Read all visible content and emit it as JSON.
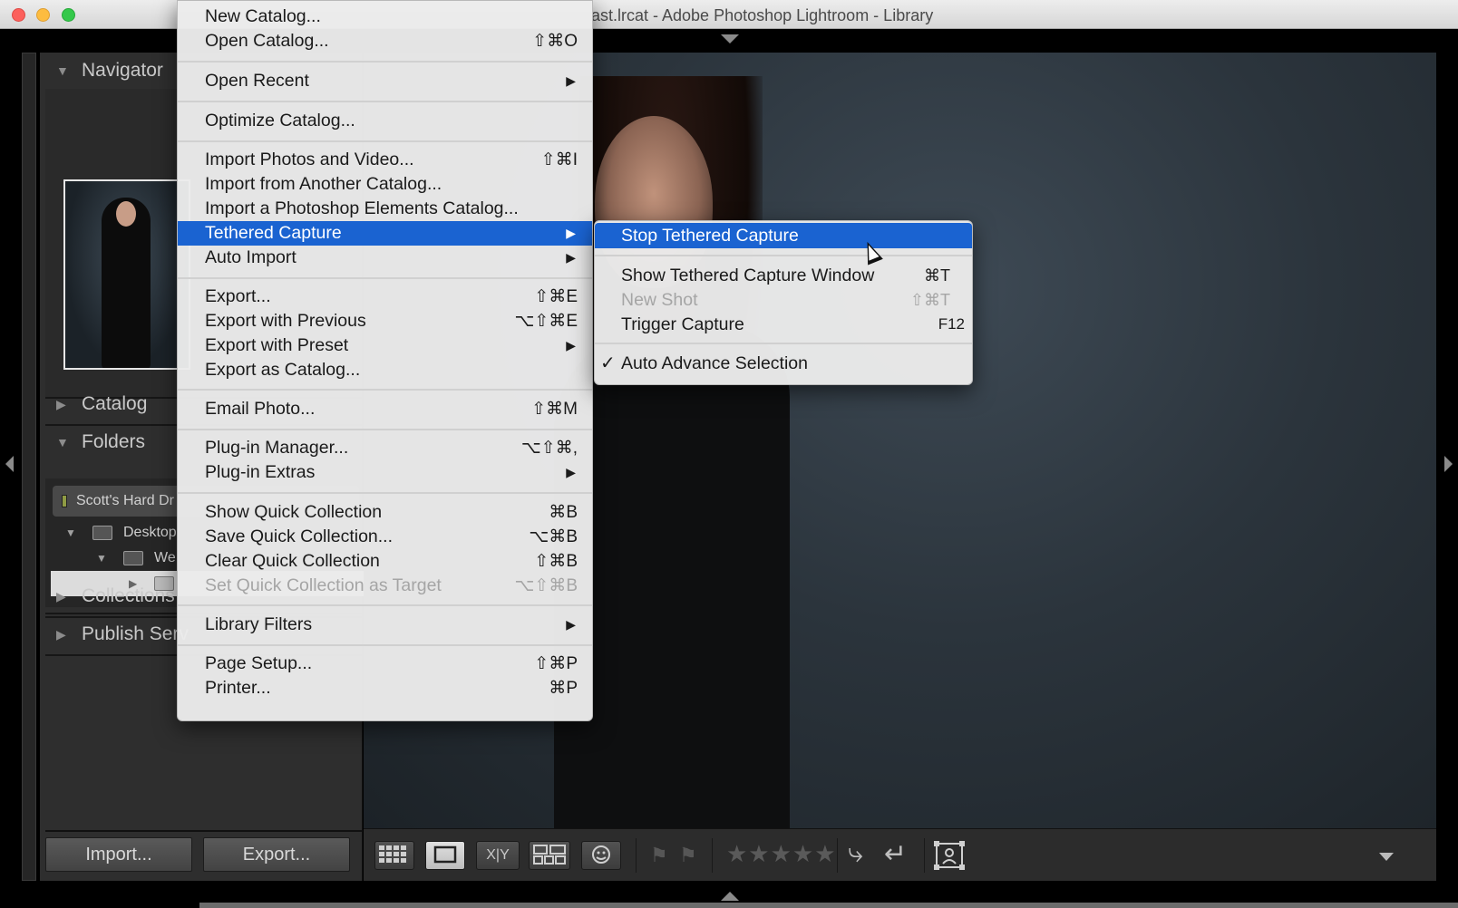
{
  "window": {
    "title": "ast.lrcat - Adobe Photoshop Lightroom - Library"
  },
  "left_panel": {
    "navigator": {
      "label": "Navigator"
    },
    "catalog": {
      "label": "Catalog"
    },
    "folders": {
      "label": "Folders",
      "volume": "Scott's Hard Dr",
      "items": [
        {
          "label": "Desktop"
        },
        {
          "label": "We"
        },
        {
          "label": ""
        }
      ]
    },
    "collections": {
      "label": "Collections"
    },
    "publish": {
      "label": "Publish Serv"
    },
    "import_button": "Import...",
    "export_button": "Export..."
  },
  "toolbar": {
    "compare_label": "X|Y",
    "stars": "★★★★★"
  },
  "file_menu": {
    "items": [
      {
        "label": "New Catalog...",
        "shortcut": ""
      },
      {
        "label": "Open Catalog...",
        "shortcut": "⇧⌘O"
      },
      {
        "label": "Open Recent",
        "shortcut": "",
        "submenu": true
      },
      {
        "label": "Optimize Catalog...",
        "shortcut": ""
      },
      {
        "label": "Import Photos and Video...",
        "shortcut": "⇧⌘I"
      },
      {
        "label": "Import from Another Catalog...",
        "shortcut": ""
      },
      {
        "label": "Import a Photoshop Elements Catalog...",
        "shortcut": ""
      },
      {
        "label": "Tethered Capture",
        "shortcut": "",
        "submenu": true,
        "highlighted": true
      },
      {
        "label": "Auto Import",
        "shortcut": "",
        "submenu": true
      },
      {
        "label": "Export...",
        "shortcut": "⇧⌘E"
      },
      {
        "label": "Export with Previous",
        "shortcut": "⌥⇧⌘E"
      },
      {
        "label": "Export with Preset",
        "shortcut": "",
        "submenu": true
      },
      {
        "label": "Export as Catalog...",
        "shortcut": ""
      },
      {
        "label": "Email Photo...",
        "shortcut": "⇧⌘M"
      },
      {
        "label": "Plug-in Manager...",
        "shortcut": "⌥⇧⌘,"
      },
      {
        "label": "Plug-in Extras",
        "shortcut": "",
        "submenu": true
      },
      {
        "label": "Show Quick Collection",
        "shortcut": "⌘B"
      },
      {
        "label": "Save Quick Collection...",
        "shortcut": "⌥⌘B"
      },
      {
        "label": "Clear Quick Collection",
        "shortcut": "⇧⌘B"
      },
      {
        "label": "Set Quick Collection as Target",
        "shortcut": "⌥⇧⌘B",
        "disabled": true
      },
      {
        "label": "Library Filters",
        "shortcut": "",
        "submenu": true
      },
      {
        "label": "Page Setup...",
        "shortcut": "⇧⌘P"
      },
      {
        "label": "Printer...",
        "shortcut": "⌘P"
      }
    ]
  },
  "tethered_submenu": {
    "items": [
      {
        "label": "Stop Tethered Capture",
        "shortcut": "",
        "highlighted": true
      },
      {
        "label": "Show Tethered Capture Window",
        "shortcut": "⌘T"
      },
      {
        "label": "New Shot",
        "shortcut": "⇧⌘T",
        "disabled": true
      },
      {
        "label": "Trigger Capture",
        "shortcut": "F12"
      },
      {
        "label": "Auto Advance Selection",
        "shortcut": "",
        "checked": true,
        "check_mark": "✓"
      }
    ]
  },
  "colors": {
    "menu_highlight": "#1a63d1",
    "panel_bg": "#2e2e2e"
  }
}
